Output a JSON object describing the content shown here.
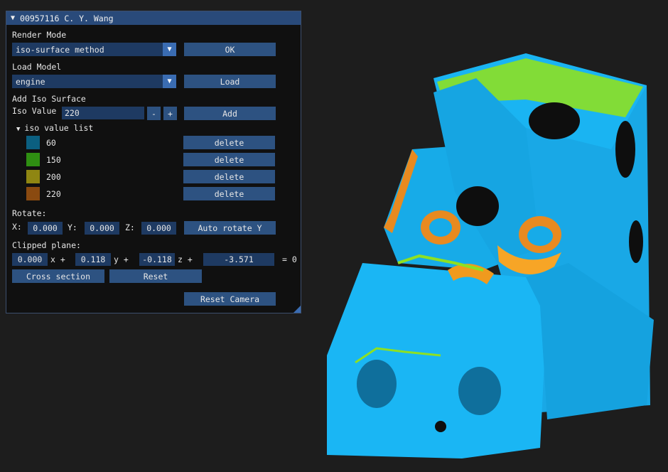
{
  "window": {
    "title": "00957116 C. Y. Wang"
  },
  "render_mode": {
    "label": "Render Mode",
    "value": "iso-surface method",
    "ok_label": "OK"
  },
  "load_model": {
    "label": "Load Model",
    "value": "engine",
    "load_label": "Load"
  },
  "add_iso": {
    "label": "Add Iso Surface",
    "value_label": "Iso Value",
    "value": "220",
    "minus": "-",
    "plus": "+",
    "add_label": "Add"
  },
  "iso_list": {
    "header": "iso value list",
    "items": [
      {
        "value": "60",
        "color": "#0b5f80",
        "delete_label": "delete"
      },
      {
        "value": "150",
        "color": "#2f8f12",
        "delete_label": "delete"
      },
      {
        "value": "200",
        "color": "#8f8612",
        "delete_label": "delete"
      },
      {
        "value": "220",
        "color": "#8a4a10",
        "delete_label": "delete"
      }
    ]
  },
  "rotate": {
    "label": "Rotate:",
    "x_label": "X:",
    "x": "0.000",
    "y_label": "Y:",
    "y": "0.000",
    "z_label": "Z:",
    "z": "0.000",
    "auto_label": "Auto rotate Y"
  },
  "clip": {
    "label": "Clipped plane:",
    "a": "0.000",
    "x_term": "x +",
    "b": "0.118",
    "y_term": "y +",
    "c": "-0.118",
    "z_term": "z +",
    "d": "-3.571",
    "eq": "= 0",
    "cross_label": "Cross section",
    "reset_label": "Reset"
  },
  "camera": {
    "reset_label": "Reset Camera"
  },
  "colors": {
    "accent": "#3a6cb2",
    "button": "#2d5281",
    "field": "#1e3a62",
    "title": "#294a7a",
    "model_primary": "#18b2f0",
    "model_green": "#7fe020",
    "model_orange": "#f0a020"
  }
}
